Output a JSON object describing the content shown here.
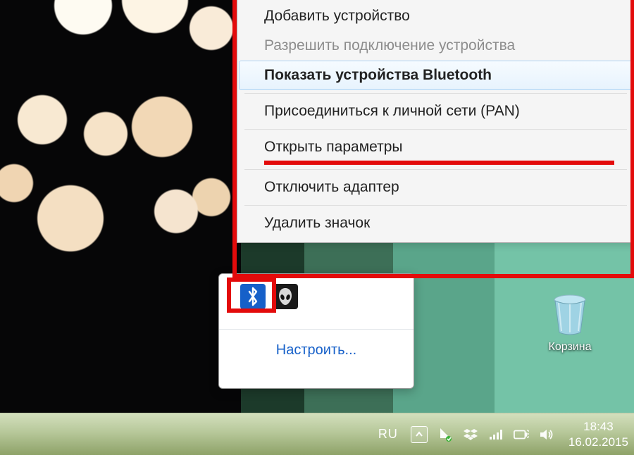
{
  "context_menu": {
    "items": [
      {
        "label": "Добавить устройство",
        "state": "normal"
      },
      {
        "label": "Разрешить подключение устройства",
        "state": "disabled"
      },
      {
        "label": "Показать устройства Bluetooth",
        "state": "hover"
      },
      {
        "label": "Присоединиться к личной сети (PAN)",
        "state": "normal"
      },
      {
        "label": "Открыть параметры",
        "state": "normal",
        "underlined": true
      },
      {
        "label": "Отключить адаптер",
        "state": "normal"
      },
      {
        "label": "Удалить значок",
        "state": "normal"
      }
    ]
  },
  "tray_popup": {
    "icons": {
      "bluetooth": "bluetooth-icon",
      "alien": "alien-icon"
    },
    "customize_label": "Настроить..."
  },
  "desktop": {
    "recycle_bin_label": "Корзина"
  },
  "taskbar": {
    "language": "RU",
    "time": "18:43",
    "date": "16.02.2015"
  },
  "annotations": {
    "highlight_color": "#e30b0b"
  }
}
